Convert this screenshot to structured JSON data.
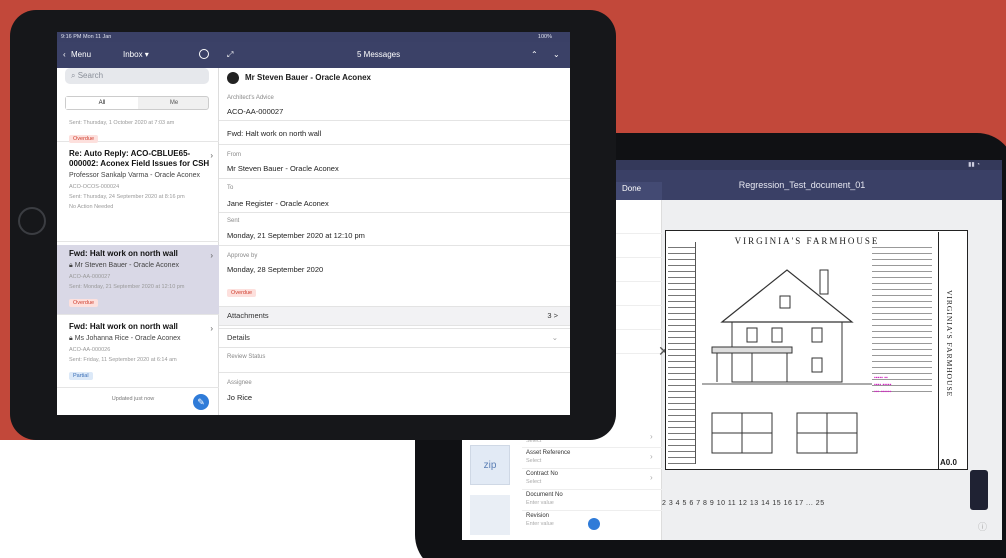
{
  "back": {
    "doc_title": "Regression_Test_document_01",
    "done_label": "Done",
    "fields": [
      {
        "label": "Asset Reference",
        "value": "Select"
      },
      {
        "label": "Contract No",
        "value": "Select"
      },
      {
        "label": "Document No",
        "value": "Enter value"
      },
      {
        "label": "Revision",
        "value": "Enter value"
      }
    ],
    "select_top": "Select",
    "zip_label": "zip",
    "drawing_title": "VIRGINIA'S FARMHOUSE",
    "side_title": "VIRGINIA'S FARMHOUSE",
    "sheet": "A0.0",
    "page_numbers": "2  3  4  5  6  7  8  9  10  11  12  13  14  15  16  17  ...  25",
    "info_icon": "ⓘ"
  },
  "front": {
    "status_left": "9:16 PM   Mon 11 Jan",
    "status_right": "100%",
    "menu_label": "Menu",
    "inbox_label": "Inbox ▾",
    "messages_title": "5 Messages",
    "search_placeholder": "Search",
    "seg_all": "All",
    "seg_me": "Me",
    "list": [
      {
        "sent": "Sent: Thursday, 1 October 2020 at 7:03 am",
        "badge": "Overdue"
      },
      {
        "title": "Re: Auto Reply: ACO-CBLUE65-000002: Aconex Field Issues for CSH",
        "from": "Professor Sankalp Varma - Oracle Aconex",
        "ref": "ACO-OCOS-000024",
        "sent": "Sent: Thursday, 24 September 2020 at 8:16 pm",
        "note": "No Action Needed"
      },
      {
        "title": "Fwd: Halt work on north wall",
        "from": "Mr Steven Bauer - Oracle Aconex",
        "ref": "ACO-AA-000027",
        "sent": "Sent: Monday, 21 September 2020 at 12:10 pm",
        "badge": "Overdue"
      },
      {
        "title": "Fwd: Halt work on north wall",
        "from": "Ms Johanna Rice - Oracle Aconex",
        "ref": "ACO-AA-000026",
        "sent": "Sent: Friday, 11 September 2020 at 6:14 am",
        "badge": "Partial"
      }
    ],
    "updated": "Updated just now",
    "detail": {
      "sender": "Mr Steven Bauer - Oracle Aconex",
      "type": "Architect's Advice",
      "number": "ACO-AA-000027",
      "subject": "Fwd: Halt work on north wall",
      "from_label": "From",
      "from": "Mr Steven Bauer - Oracle Aconex",
      "to_label": "To",
      "to": "Jane Register - Oracle Aconex",
      "sent_label": "Sent",
      "sent": "Monday, 21 September 2020 at 12:10 pm",
      "approve_label": "Approve by",
      "approve": "Monday, 28 September 2020",
      "badge": "Overdue",
      "attachments": "Attachments",
      "attach_count": "3 >",
      "details": "Details",
      "review_label": "Review Status",
      "assignee_label": "Assignee",
      "assignee": "Jo Rice"
    }
  }
}
